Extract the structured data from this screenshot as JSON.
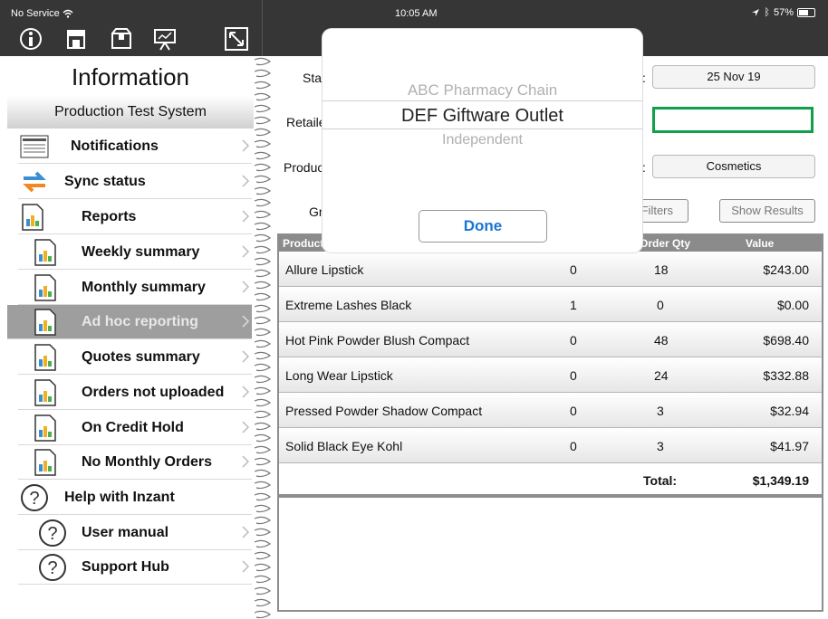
{
  "status_bar": {
    "carrier": "No Service",
    "time": "10:05 AM",
    "battery": "57%"
  },
  "toolbar": {
    "icons": [
      "info-icon",
      "store-icon",
      "box-icon",
      "presentation-icon",
      "resize-icon"
    ]
  },
  "left_panel": {
    "title": "Information",
    "subtitle": "Production Test System",
    "items": [
      {
        "label": "Notifications",
        "icon": "newspaper-icon"
      },
      {
        "label": "Sync status",
        "icon": "sync-icon"
      },
      {
        "label": "Reports",
        "icon": "report-icon"
      },
      {
        "label": "Weekly summary",
        "icon": "report-icon"
      },
      {
        "label": "Monthly summary",
        "icon": "report-icon"
      },
      {
        "label": "Ad hoc reporting",
        "icon": "report-icon",
        "selected": true
      },
      {
        "label": "Quotes summary",
        "icon": "report-icon"
      },
      {
        "label": "Orders not uploaded",
        "icon": "report-icon"
      },
      {
        "label": "On Credit Hold",
        "icon": "report-icon"
      },
      {
        "label": "No Monthly Orders",
        "icon": "report-icon"
      },
      {
        "label": "Help with Inzant",
        "icon": "help-icon"
      },
      {
        "label": "User manual",
        "icon": "help-icon"
      },
      {
        "label": "Support Hub",
        "icon": "help-icon"
      }
    ]
  },
  "form": {
    "label_start": "Sta",
    "label_retailer": "Retaile",
    "label_product": "Produc",
    "label_group": "Gr",
    "colon": ":",
    "date_value": "25 Nov 19",
    "product_value": "Cosmetics",
    "filters_button": "Filters",
    "show_results_button": "Show Results"
  },
  "table": {
    "headers": [
      "Product",
      "Order Qty",
      "Value"
    ],
    "rows": [
      {
        "product": "Allure Lipstick",
        "col2": "0",
        "qty": "18",
        "value": "$243.00"
      },
      {
        "product": "Extreme Lashes Black",
        "col2": "1",
        "qty": "0",
        "value": "$0.00"
      },
      {
        "product": "Hot Pink Powder Blush Compact",
        "col2": "0",
        "qty": "48",
        "value": "$698.40"
      },
      {
        "product": "Long Wear Lipstick",
        "col2": "0",
        "qty": "24",
        "value": "$332.88"
      },
      {
        "product": "Pressed Powder Shadow Compact",
        "col2": "0",
        "qty": "3",
        "value": "$32.94"
      },
      {
        "product": "Solid Black Eye Kohl",
        "col2": "0",
        "qty": "3",
        "value": "$41.97"
      }
    ],
    "total_label": "Total:",
    "total_value": "$1,349.19"
  },
  "picker": {
    "options": [
      "ABC Pharmacy Chain",
      "DEF Giftware Outlet",
      "Independent"
    ],
    "selected": "DEF Giftware Outlet",
    "done_label": "Done"
  }
}
